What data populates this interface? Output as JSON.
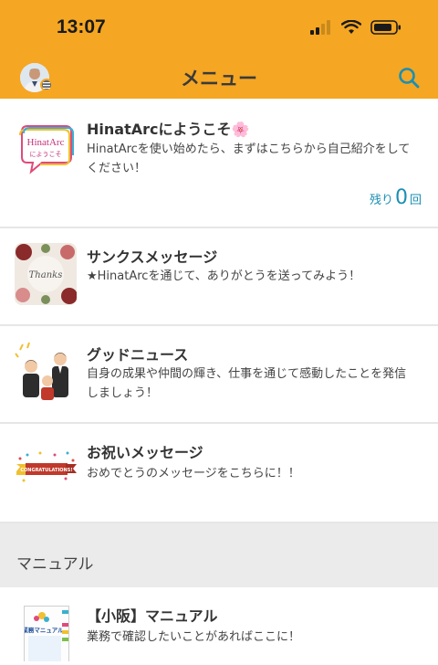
{
  "status_bar": {
    "time": "13:07"
  },
  "header": {
    "title": "メニュー"
  },
  "menu_items": [
    {
      "title": "HinatArcにようこそ🌸",
      "description": "HinatArcを使い始めたら、まずはこちらから自己紹介をしてください！",
      "remaining_prefix": "残り",
      "remaining_count": "0",
      "remaining_suffix": "回",
      "thumb_text": "HinatArc",
      "thumb_sub": "にようこそ"
    },
    {
      "title": "サンクスメッセージ",
      "description": "★HinatArcを通じて、ありがとうを送ってみよう！",
      "thumb_text": "Thanks"
    },
    {
      "title": "グッドニュース",
      "description": "自身の成果や仲間の輝き、仕事を通じて感動したことを発信しましょう！"
    },
    {
      "title": "お祝いメッセージ",
      "description": "おめでとうのメッセージをこちらに！！",
      "thumb_text": "CONGRATULATIONS!"
    }
  ],
  "section": {
    "label": "マニュアル"
  },
  "manual_item": {
    "title": "【小阪】マニュアル",
    "description": "業務で確認したいことがあればここに！",
    "thumb_text": "業務マニュアル"
  },
  "colors": {
    "header": "#f5a623",
    "accent": "#1a8fb3"
  }
}
